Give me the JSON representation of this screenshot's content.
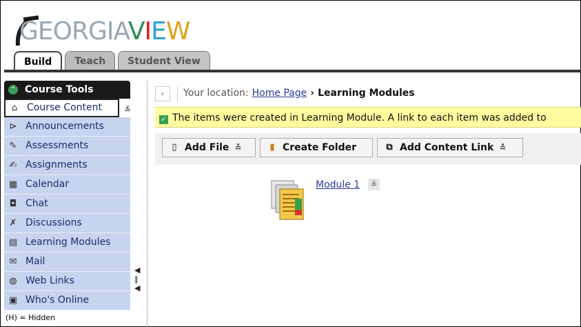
{
  "brand": {
    "logo_left": "GEORGIA",
    "logo_right_v": "V",
    "logo_right_i": "I",
    "logo_right_e": "E",
    "logo_right_w": "W"
  },
  "tabs": [
    {
      "label": "Build",
      "active": true
    },
    {
      "label": "Teach",
      "active": false
    },
    {
      "label": "Student View",
      "active": false
    }
  ],
  "sidebar": {
    "title": "Course Tools",
    "items": [
      {
        "label": "Course Content",
        "icon": "home-icon",
        "current": true
      },
      {
        "label": "Announcements",
        "icon": "megaphone-icon"
      },
      {
        "label": "Assessments",
        "icon": "assessment-icon"
      },
      {
        "label": "Assignments",
        "icon": "assignment-icon"
      },
      {
        "label": "Calendar",
        "icon": "calendar-icon"
      },
      {
        "label": "Chat",
        "icon": "chat-icon"
      },
      {
        "label": "Discussions",
        "icon": "pin-icon"
      },
      {
        "label": "Learning Modules",
        "icon": "modules-icon"
      },
      {
        "label": "Mail",
        "icon": "mail-icon"
      },
      {
        "label": "Web Links",
        "icon": "globe-icon"
      },
      {
        "label": "Who's Online",
        "icon": "person-icon"
      }
    ],
    "hidden_note": "(H) = Hidden"
  },
  "location": {
    "prefix": "Your location:",
    "home_link": "Home Page",
    "separator": "›",
    "current": "Learning Modules"
  },
  "message": "The items were created in Learning Module. A link to each item was added to",
  "toolbar": {
    "add_file": "Add File",
    "create_folder": "Create Folder",
    "add_content_link": "Add Content Link"
  },
  "content": {
    "module_link": "Module 1"
  },
  "colors": {
    "sidebar_bg": "#c7d4ef",
    "message_bg": "#fffb9e",
    "link": "#2a3a9a"
  }
}
